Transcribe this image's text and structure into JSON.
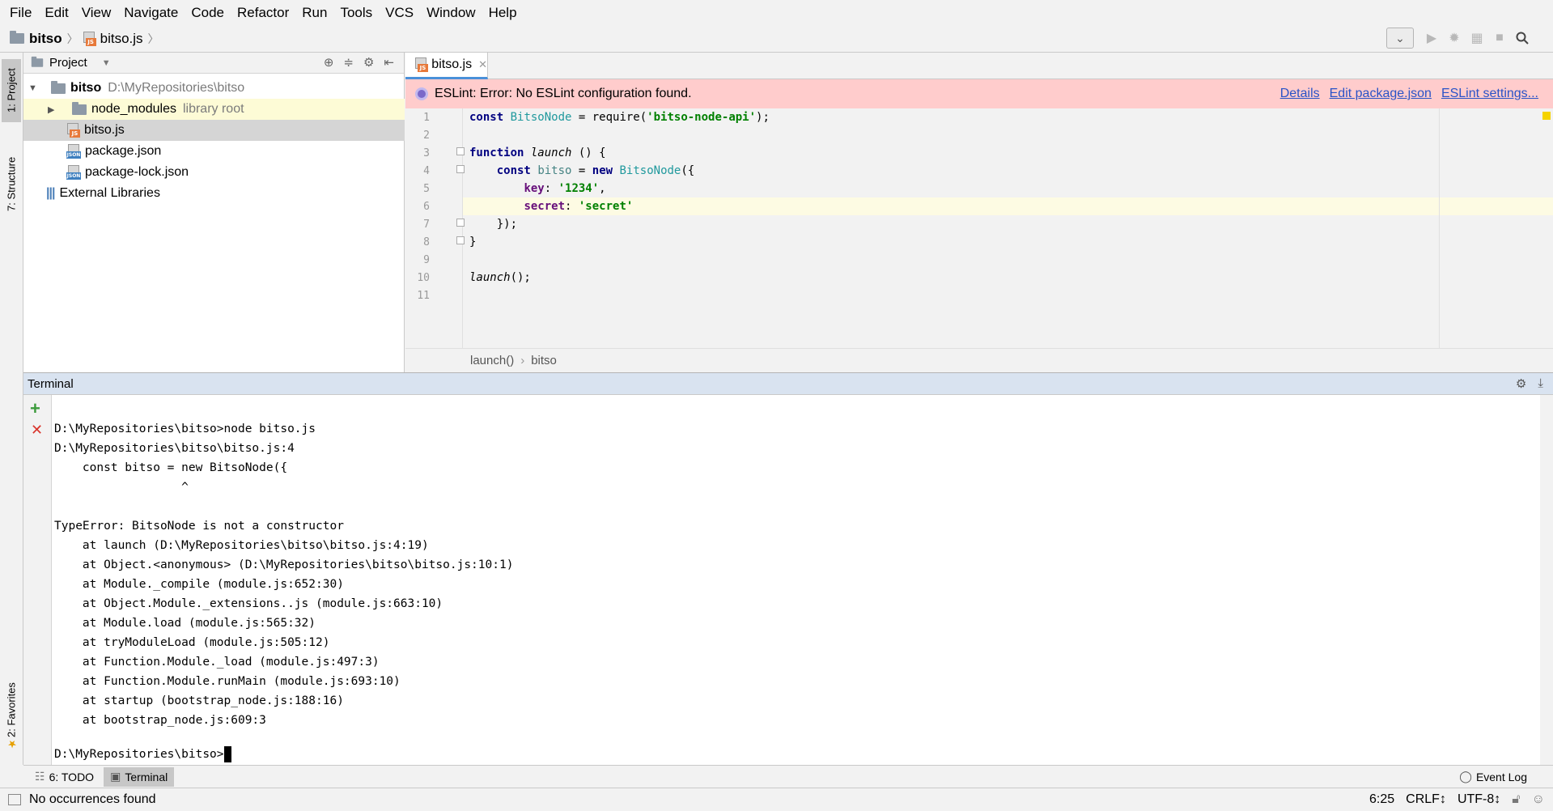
{
  "menu": [
    "File",
    "Edit",
    "View",
    "Navigate",
    "Code",
    "Refactor",
    "Run",
    "Tools",
    "VCS",
    "Window",
    "Help"
  ],
  "nav": {
    "project": "bitso",
    "file": "bitso.js"
  },
  "left_strip": {
    "project_tab": "1: Project",
    "structure_tab": "7: Structure",
    "favorites_tab": "2: Favorites"
  },
  "project_panel": {
    "header": "Project",
    "root_name": "bitso",
    "root_path": "D:\\MyRepositories\\bitso",
    "node_modules": "node_modules",
    "node_modules_note": "library root",
    "files": [
      "bitso.js",
      "package.json",
      "package-lock.json"
    ],
    "external": "External Libraries"
  },
  "editor": {
    "tab": "bitso.js",
    "eslint_message": "ESLint: Error: No ESLint configuration found.",
    "eslint_links": [
      "Details",
      "Edit package.json",
      "ESLint settings..."
    ],
    "line_numbers": [
      "1",
      "2",
      "3",
      "4",
      "5",
      "6",
      "7",
      "8",
      "9",
      "10",
      "11"
    ],
    "breadcrumb": [
      "launch()",
      "bitso"
    ],
    "code": {
      "l1_kw": "const",
      "l1_cls": "BitsoNode",
      "l1_mid": " = require(",
      "l1_str": "'bitso-node-api'",
      "l1_end": ");",
      "l3_kw": "function",
      "l3_fn": "launch",
      "l3_end": " () {",
      "l4_kw": "const",
      "l4_var": "bitso",
      "l4_eq": " = ",
      "l4_new": "new",
      "l4_cls": "BitsoNode",
      "l4_end": "({",
      "l5_prop": "key",
      "l5_colon": ": ",
      "l5_str": "'1234'",
      "l5_end": ",",
      "l6_prop": "secret",
      "l6_colon": ": ",
      "l6_str": "'secret'",
      "l7": "});",
      "l8": "}",
      "l10_fn": "launch",
      "l10_end": "();"
    }
  },
  "terminal": {
    "title": "Terminal",
    "lines": [
      "",
      "D:\\MyRepositories\\bitso>node bitso.js",
      "D:\\MyRepositories\\bitso\\bitso.js:4",
      "    const bitso = new BitsoNode({",
      "                  ^",
      "",
      "TypeError: BitsoNode is not a constructor",
      "    at launch (D:\\MyRepositories\\bitso\\bitso.js:4:19)",
      "    at Object.<anonymous> (D:\\MyRepositories\\bitso\\bitso.js:10:1)",
      "    at Module._compile (module.js:652:30)",
      "    at Object.Module._extensions..js (module.js:663:10)",
      "    at Module.load (module.js:565:32)",
      "    at tryModuleLoad (module.js:505:12)",
      "    at Function.Module._load (module.js:497:3)",
      "    at Function.Module.runMain (module.js:693:10)",
      "    at startup (bootstrap_node.js:188:16)",
      "    at bootstrap_node.js:609:3",
      "",
      "D:\\MyRepositories\\bitso>"
    ]
  },
  "bottom_tabs": {
    "todo": "6: TODO",
    "terminal": "Terminal",
    "event_log": "Event Log"
  },
  "status": {
    "message": "No occurrences found",
    "position": "6:25",
    "line_sep": "CRLF↕",
    "encoding": "UTF-8↕"
  },
  "colors": {
    "eslint_bg": "#ffcccc",
    "terminal_header": "#d9e3f0",
    "keyword": "#000080",
    "string": "#008000"
  }
}
